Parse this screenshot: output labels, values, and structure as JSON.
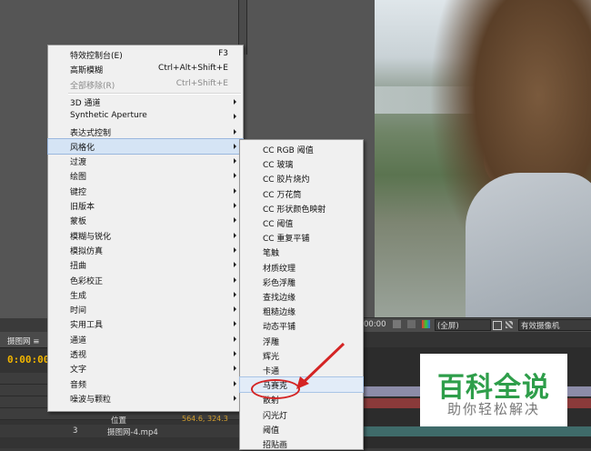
{
  "main_menu": {
    "items": [
      {
        "label": "特效控制台(E)",
        "shortcut": "F3"
      },
      {
        "label": "高斯模糊",
        "shortcut": "Ctrl+Alt+Shift+E"
      },
      {
        "label": "全部移除(R)",
        "shortcut": "Ctrl+Shift+E",
        "disabled": true
      },
      {
        "label": "3D 通道",
        "submenu": true
      },
      {
        "label": "Synthetic Aperture",
        "submenu": true
      },
      {
        "label": "表达式控制",
        "submenu": true
      },
      {
        "label": "风格化",
        "submenu": true,
        "highlighted": true
      },
      {
        "label": "过渡",
        "submenu": true
      },
      {
        "label": "绘图",
        "submenu": true
      },
      {
        "label": "键控",
        "submenu": true
      },
      {
        "label": "旧版本",
        "submenu": true
      },
      {
        "label": "蒙板",
        "submenu": true
      },
      {
        "label": "模糊与锐化",
        "submenu": true
      },
      {
        "label": "模拟仿真",
        "submenu": true
      },
      {
        "label": "扭曲",
        "submenu": true
      },
      {
        "label": "色彩校正",
        "submenu": true
      },
      {
        "label": "生成",
        "submenu": true
      },
      {
        "label": "时间",
        "submenu": true
      },
      {
        "label": "实用工具",
        "submenu": true
      },
      {
        "label": "通道",
        "submenu": true
      },
      {
        "label": "透视",
        "submenu": true
      },
      {
        "label": "文字",
        "submenu": true
      },
      {
        "label": "音频",
        "submenu": true
      },
      {
        "label": "噪波与颗粒",
        "submenu": true
      }
    ]
  },
  "submenu": {
    "items": [
      {
        "label": "CC RGB 阈值"
      },
      {
        "label": "CC 玻璃"
      },
      {
        "label": "CC 胶片烧灼"
      },
      {
        "label": "CC 万花筒"
      },
      {
        "label": "CC 形状颜色映射"
      },
      {
        "label": "CC 阈值"
      },
      {
        "label": "CC 重复平铺"
      },
      {
        "label": "笔触"
      },
      {
        "label": "材质纹理"
      },
      {
        "label": "彩色浮雕"
      },
      {
        "label": "查找边缘"
      },
      {
        "label": "粗糙边缘"
      },
      {
        "label": "动态平铺"
      },
      {
        "label": "浮雕"
      },
      {
        "label": "辉光"
      },
      {
        "label": "卡通"
      },
      {
        "label": "马赛克",
        "highlighted": true
      },
      {
        "label": "散射"
      },
      {
        "label": "闪光灯"
      },
      {
        "label": "阈值"
      },
      {
        "label": "招贴画"
      }
    ]
  },
  "viewer_bar": {
    "timecode": "00:00",
    "resolution": "(全屏)",
    "camera": "有效摄像机"
  },
  "timeline": {
    "tab_label": "摄图网 ≡",
    "timecode": "0:00:00",
    "property_label": "位置",
    "property_value": "564.6, 324.3",
    "layer_number": "3",
    "layer_name": "摄图网-4.mp4"
  },
  "watermark": {
    "title": "百科全说",
    "subtitle": "助你轻松解决"
  },
  "colors": {
    "menu_bg": "#f0f0f0",
    "highlight": "#d5e4f5",
    "annotation_red": "#d42424",
    "timecode_orange": "#f0b400",
    "watermark_green": "#2e9e4a"
  }
}
